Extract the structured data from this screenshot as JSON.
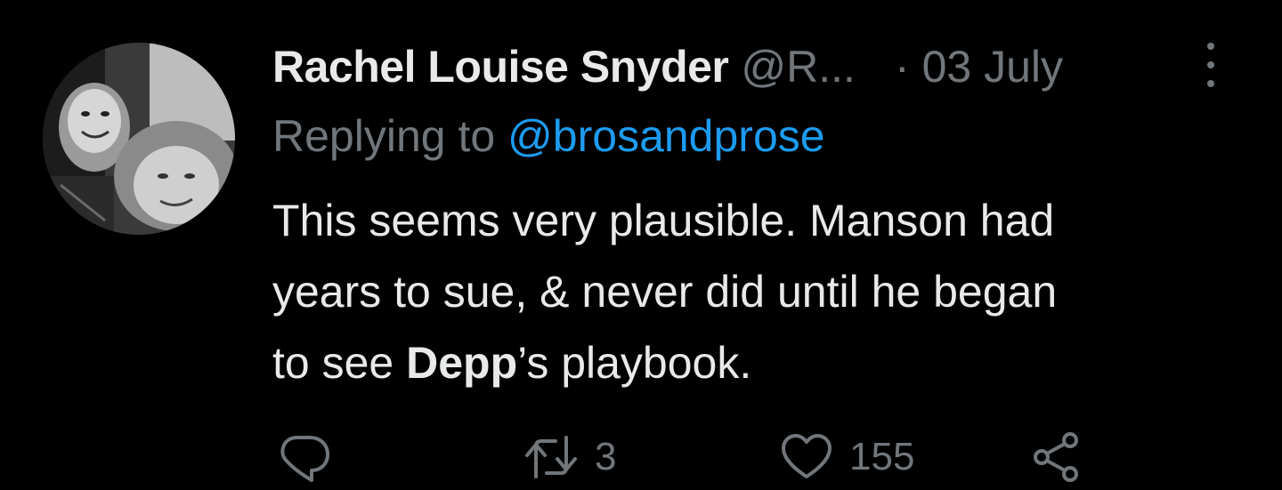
{
  "tweet": {
    "display_name": "Rachel Louise Snyder",
    "handle": "@R...",
    "separator": "·",
    "date": "03 July",
    "replying_prefix": "Replying to ",
    "replying_to": "@brosandprose",
    "body_line1": "This seems very plausible. Manson had",
    "body_line2": "years to sue, & never did until he began",
    "body_line3_pre": "to see ",
    "body_line3_bold": "Depp",
    "body_line3_post": "’s playbook."
  },
  "actions": {
    "reply_icon": "reply-bubble-icon",
    "retweet_icon": "retweet-icon",
    "retweet_count": "3",
    "like_icon": "heart-icon",
    "like_count": "155",
    "share_icon": "share-nodes-icon"
  },
  "colors": {
    "background": "#000000",
    "primary_text": "#e7e9ea",
    "secondary_text": "#71767b",
    "link": "#1d9bf0"
  }
}
